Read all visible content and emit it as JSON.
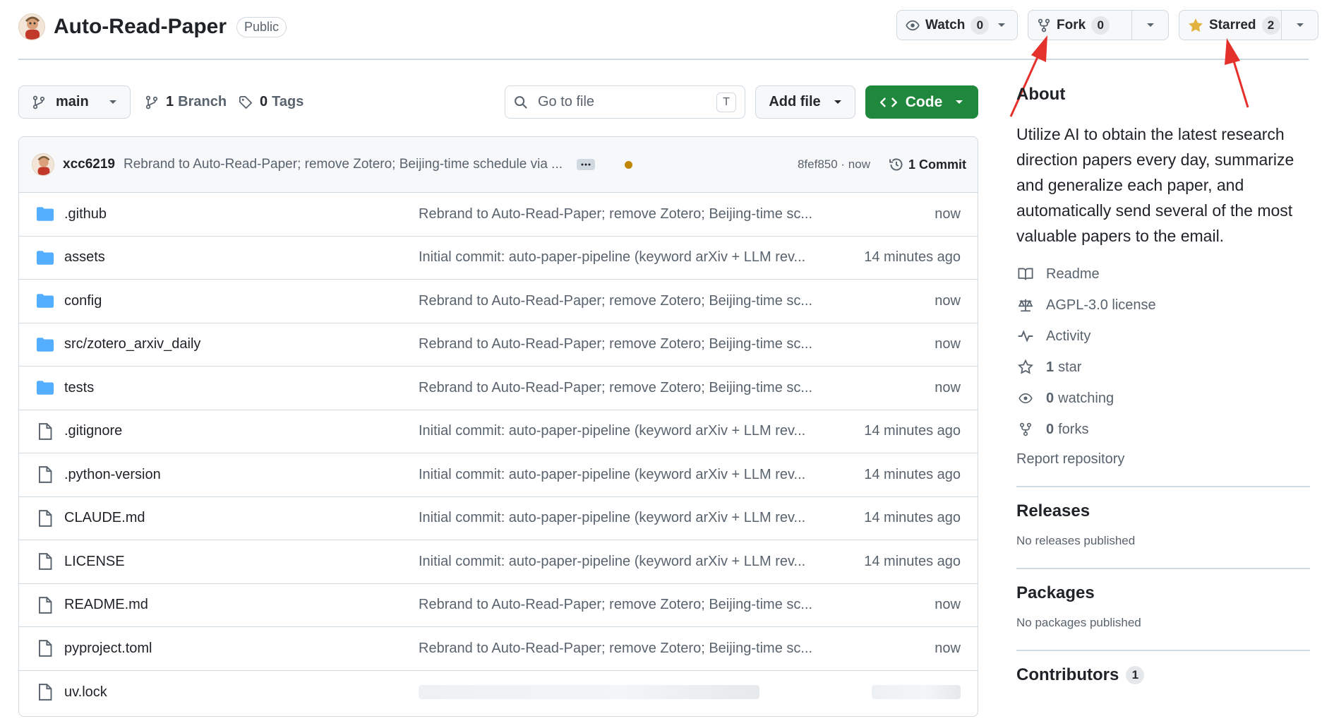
{
  "repo": {
    "name": "Auto-Read-Paper",
    "visibility": "Public"
  },
  "actions": {
    "watch_label": "Watch",
    "watch_count": "0",
    "fork_label": "Fork",
    "fork_count": "0",
    "star_label": "Starred",
    "star_count": "2"
  },
  "toolbar": {
    "branch": "main",
    "branches_count": "1",
    "branches_label": "Branch",
    "tags_count": "0",
    "tags_label": "Tags",
    "search_placeholder": "Go to file",
    "search_shortcut": "T",
    "add_file_label": "Add file",
    "code_label": "Code"
  },
  "latest_commit": {
    "author": "xcc6219",
    "message": "Rebrand to Auto-Read-Paper; remove Zotero; Beijing-time schedule via ...",
    "sha_time": "8fef850 · now",
    "commit_count_label": "1 Commit"
  },
  "files": [
    {
      "name": ".github",
      "type": "folder",
      "message": "Rebrand to Auto-Read-Paper; remove Zotero; Beijing-time sc...",
      "time": "now"
    },
    {
      "name": "assets",
      "type": "folder",
      "message": "Initial commit: auto-paper-pipeline (keyword arXiv + LLM rev...",
      "time": "14 minutes ago"
    },
    {
      "name": "config",
      "type": "folder",
      "message": "Rebrand to Auto-Read-Paper; remove Zotero; Beijing-time sc...",
      "time": "now"
    },
    {
      "name": "src/zotero_arxiv_daily",
      "type": "folder",
      "message": "Rebrand to Auto-Read-Paper; remove Zotero; Beijing-time sc...",
      "time": "now"
    },
    {
      "name": "tests",
      "type": "folder",
      "message": "Rebrand to Auto-Read-Paper; remove Zotero; Beijing-time sc...",
      "time": "now"
    },
    {
      "name": ".gitignore",
      "type": "file",
      "message": "Initial commit: auto-paper-pipeline (keyword arXiv + LLM rev...",
      "time": "14 minutes ago"
    },
    {
      "name": ".python-version",
      "type": "file",
      "message": "Initial commit: auto-paper-pipeline (keyword arXiv + LLM rev...",
      "time": "14 minutes ago"
    },
    {
      "name": "CLAUDE.md",
      "type": "file",
      "message": "Initial commit: auto-paper-pipeline (keyword arXiv + LLM rev...",
      "time": "14 minutes ago"
    },
    {
      "name": "LICENSE",
      "type": "file",
      "message": "Initial commit: auto-paper-pipeline (keyword arXiv + LLM rev...",
      "time": "14 minutes ago"
    },
    {
      "name": "README.md",
      "type": "file",
      "message": "Rebrand to Auto-Read-Paper; remove Zotero; Beijing-time sc...",
      "time": "now"
    },
    {
      "name": "pyproject.toml",
      "type": "file",
      "message": "Rebrand to Auto-Read-Paper; remove Zotero; Beijing-time sc...",
      "time": "now"
    },
    {
      "name": "uv.lock",
      "type": "file",
      "message": "",
      "time": ""
    }
  ],
  "about": {
    "title": "About",
    "description": "Utilize AI to obtain the latest research direction papers every day, summarize and generalize each paper, and automatically send several of the most valuable papers to the email.",
    "readme": "Readme",
    "license": "AGPL-3.0 license",
    "activity": "Activity",
    "stars_count": "1",
    "stars_label": "star",
    "watching_count": "0",
    "watching_label": "watching",
    "forks_count": "0",
    "forks_label": "forks",
    "report": "Report repository"
  },
  "releases": {
    "title": "Releases",
    "empty": "No releases published"
  },
  "packages": {
    "title": "Packages",
    "empty": "No packages published"
  },
  "contributors": {
    "title": "Contributors",
    "count": "1"
  },
  "colors": {
    "accent_green": "#1f883d",
    "star_yellow": "#e3b341",
    "folder_blue": "#54aeff",
    "annotation_red": "#e5312b"
  }
}
